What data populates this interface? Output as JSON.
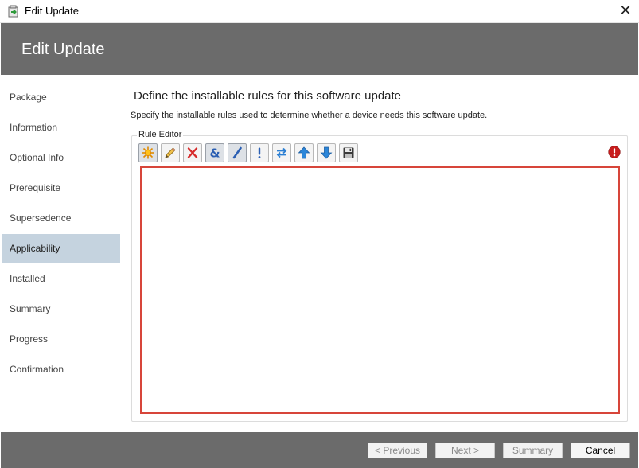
{
  "window": {
    "title": "Edit Update",
    "close_glyph": "✕",
    "icon": "app-update-icon"
  },
  "header": {
    "title": "Edit Update"
  },
  "sidebar": {
    "items": [
      {
        "label": "Package",
        "active": false
      },
      {
        "label": "Information",
        "active": false
      },
      {
        "label": "Optional Info",
        "active": false
      },
      {
        "label": "Prerequisite",
        "active": false
      },
      {
        "label": "Supersedence",
        "active": false
      },
      {
        "label": "Applicability",
        "active": true
      },
      {
        "label": "Installed",
        "active": false
      },
      {
        "label": "Summary",
        "active": false
      },
      {
        "label": "Progress",
        "active": false
      },
      {
        "label": "Confirmation",
        "active": false
      }
    ]
  },
  "main": {
    "heading": "Define the installable rules for this software update",
    "description": "Specify the installable rules used to determine whether a device needs this software update.",
    "rule_editor": {
      "label": "Rule Editor",
      "toolbar": [
        {
          "icon": "new-rule-icon",
          "pressed": true
        },
        {
          "icon": "edit-pencil-icon",
          "pressed": false
        },
        {
          "icon": "delete-x-icon",
          "pressed": false
        },
        {
          "icon": "and-ampersand-icon",
          "pressed": true
        },
        {
          "icon": "or-slash-icon",
          "pressed": true
        },
        {
          "icon": "not-exclamation-icon",
          "pressed": false
        },
        {
          "icon": "swap-arrows-icon",
          "pressed": false
        },
        {
          "icon": "move-up-icon",
          "pressed": false
        },
        {
          "icon": "move-down-icon",
          "pressed": false
        },
        {
          "icon": "save-disk-icon",
          "pressed": false
        }
      ],
      "status_icon": "error-icon"
    }
  },
  "footer": {
    "previous_label": "< Previous",
    "next_label": "Next >",
    "summary_label": "Summary",
    "cancel_label": "Cancel"
  },
  "colors": {
    "header_band": "#6b6b6b",
    "active_nav": "#c5d3df",
    "error_border": "#d7453a"
  }
}
